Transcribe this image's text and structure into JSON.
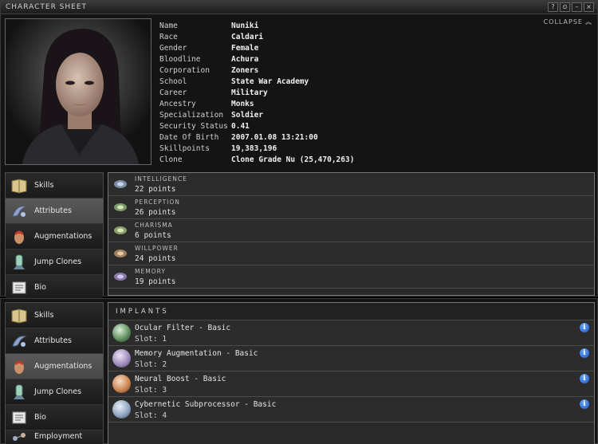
{
  "window": {
    "title": "CHARACTER SHEET",
    "buttons": [
      "?",
      "⊙",
      "–",
      "×"
    ],
    "collapse_label": "COLLAPSE"
  },
  "character": {
    "fields": [
      {
        "label": "Name",
        "value": "Nuniki"
      },
      {
        "label": "Race",
        "value": "Caldari"
      },
      {
        "label": "Gender",
        "value": "Female"
      },
      {
        "label": "Bloodline",
        "value": "Achura"
      },
      {
        "label": "Corporation",
        "value": "Zoners"
      },
      {
        "label": "School",
        "value": "State War Academy"
      },
      {
        "label": "Career",
        "value": "Military"
      },
      {
        "label": "Ancestry",
        "value": "Monks"
      },
      {
        "label": "Specialization",
        "value": "Soldier"
      },
      {
        "label": "Security Status",
        "value": "0.41"
      },
      {
        "label": "Date Of Birth",
        "value": "2007.01.08 13:21:00"
      },
      {
        "label": "Skillpoints",
        "value": "19,383,196"
      },
      {
        "label": "Clone",
        "value": "Clone Grade Nu (25,470,263)"
      }
    ]
  },
  "nav_top": {
    "items": [
      {
        "label": "Skills",
        "icon": "book-icon",
        "active": false
      },
      {
        "label": "Attributes",
        "icon": "attributes-icon",
        "active": true
      },
      {
        "label": "Augmentations",
        "icon": "augmentation-head-icon",
        "active": false
      },
      {
        "label": "Jump Clones",
        "icon": "jump-clone-icon",
        "active": false
      },
      {
        "label": "Bio",
        "icon": "bio-document-icon",
        "active": false
      }
    ]
  },
  "attributes": {
    "rows": [
      {
        "name": "INTELLIGENCE",
        "value": "22 points",
        "icon": "intelligence-icon"
      },
      {
        "name": "PERCEPTION",
        "value": "26 points",
        "icon": "perception-icon"
      },
      {
        "name": "CHARISMA",
        "value": "6 points",
        "icon": "charisma-icon"
      },
      {
        "name": "WILLPOWER",
        "value": "24 points",
        "icon": "willpower-icon"
      },
      {
        "name": "MEMORY",
        "value": "19 points",
        "icon": "memory-icon"
      }
    ]
  },
  "nav_bottom": {
    "items": [
      {
        "label": "Skills",
        "icon": "book-icon",
        "active": false
      },
      {
        "label": "Attributes",
        "icon": "attributes-icon",
        "active": false
      },
      {
        "label": "Augmentations",
        "icon": "augmentation-head-icon",
        "active": true
      },
      {
        "label": "Jump Clones",
        "icon": "jump-clone-icon",
        "active": false
      },
      {
        "label": "Bio",
        "icon": "bio-document-icon",
        "active": false
      },
      {
        "label": "Employment",
        "icon": "employment-icon",
        "active": false
      }
    ]
  },
  "implants": {
    "header": "IMPLANTS",
    "rows": [
      {
        "name": "Ocular Filter - Basic",
        "slot": "Slot: 1",
        "color": "#7cc27c"
      },
      {
        "name": "Memory Augmentation - Basic",
        "slot": "Slot: 2",
        "color": "#b9a3d8"
      },
      {
        "name": "Neural Boost - Basic",
        "slot": "Slot: 3",
        "color": "#d9955e"
      },
      {
        "name": "Cybernetic Subprocessor - Basic",
        "slot": "Slot: 4",
        "color": "#a9bfd8"
      }
    ]
  }
}
